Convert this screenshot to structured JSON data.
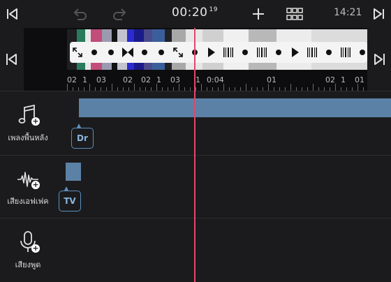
{
  "toolbar": {
    "timecode": "00:20",
    "frames": "19",
    "clock": "14:21",
    "icons": [
      "skip-to-start-icon",
      "undo-icon",
      "redo-icon",
      "add-icon",
      "grid-icon",
      "skip-to-end-icon"
    ]
  },
  "timeline": {
    "ruler_labels": [
      "02",
      "1",
      "03",
      "02",
      "02",
      "1",
      "03",
      "1",
      "0:04",
      "01",
      "02",
      "1",
      "01"
    ],
    "thumbnail_colors": [
      "#1f1f22",
      "#2a7a5c",
      "#e8e8e8",
      "#c24c7a",
      "#9b9bb0",
      "#121214",
      "#c3c3cf",
      "#2b2bd0",
      "#1a1a8a",
      "#4a4a8c",
      "#3b5f9b",
      "#222226",
      "#a8a8a8",
      "#e6e6e6",
      "#d0d0d0",
      "#f0f0f0",
      "#b8b8b8",
      "#ececec",
      "#dcdcdc"
    ],
    "playhead_color": "#e0486b"
  },
  "tracks": {
    "music": {
      "label": "เพลงพื้นหลัง",
      "tag": "Dr",
      "icon": "music-note-icon"
    },
    "effects": {
      "label": "เสียงเอฟเฟค",
      "tag": "TV",
      "icon": "waveform-icon"
    },
    "voice": {
      "label": "เสียงพูด",
      "icon": "microphone-icon"
    }
  },
  "colors": {
    "clip": "#5b82a6",
    "accent": "#5d8fbf",
    "background": "#1b1b1d"
  }
}
